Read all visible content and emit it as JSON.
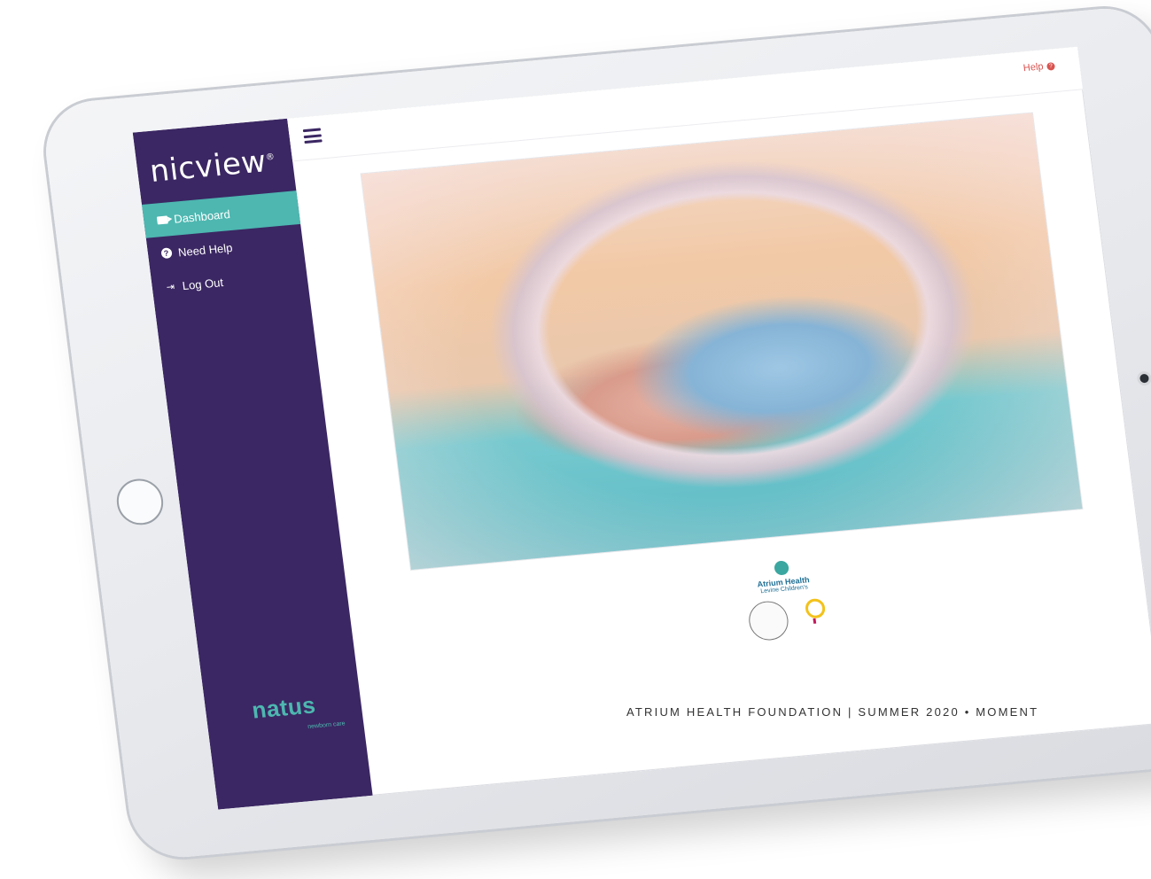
{
  "sidebar": {
    "logo": "nicview",
    "items": [
      {
        "label": "Dashboard",
        "icon": "video-camera-icon",
        "active": true
      },
      {
        "label": "Need Help",
        "icon": "question-circle-icon",
        "active": false
      },
      {
        "label": "Log Out",
        "icon": "sign-out-icon",
        "active": false
      }
    ],
    "brand": "natus",
    "brand_sub": "newborn care"
  },
  "topbar": {
    "help_label": "Help"
  },
  "sponsors": {
    "title": "Atrium Health",
    "subtitle": "Levine Children's"
  },
  "caption": "ATRIUM HEALTH FOUNDATION  |  SUMMER 2020 • MOMENT",
  "colors": {
    "sidebar": "#3b2763",
    "accent": "#4db7b0",
    "help": "#d9534f"
  }
}
